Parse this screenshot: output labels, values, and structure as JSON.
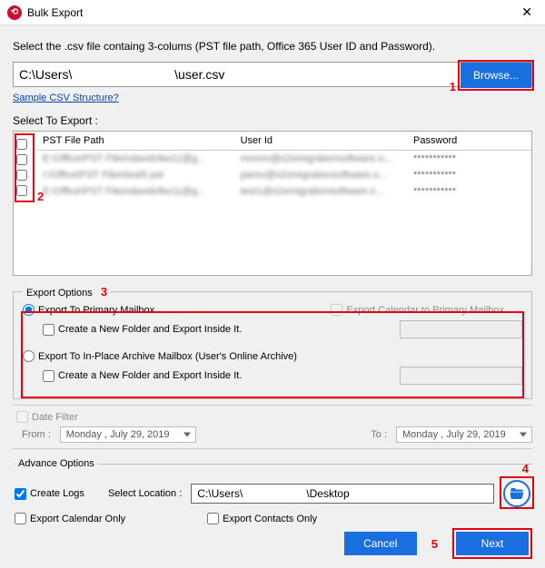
{
  "title": "Bulk Export",
  "instruction": "Select the .csv file containg 3-colums (PST file path, Office 365 User ID and Password).",
  "path_value": "C:\\Users\\                             \\user.csv",
  "browse_label": "Browse...",
  "sample_link": "Sample CSV Structure?",
  "select_label": "Select To Export :",
  "table": {
    "headers": [
      "PST File Path",
      "User Id",
      "Password"
    ],
    "rows": [
      {
        "path": "E:\\Office\\PST Files\\davidclke11@g...",
        "user": "monov@s2omigrationsoftware.o...",
        "pwd": "***********"
      },
      {
        "path": "I:\\Office\\PST Files\\test5.pst",
        "user": "parov@s2omigrationsoftware.o...",
        "pwd": "***********"
      },
      {
        "path": "E:\\Office\\PST Files\\davidclke11@g...",
        "user": "test1@s2omigrationsoftware.o...",
        "pwd": "***********"
      }
    ]
  },
  "annotations": {
    "a1": "1",
    "a2": "2",
    "a3": "3",
    "a4": "4",
    "a5": "5"
  },
  "export_options": {
    "legend": "Export Options",
    "primary": "Export To Primary Mailbox",
    "cal_primary": "Export Calendar to Primary Mailbox",
    "newfolder": "Create a New Folder and Export Inside It.",
    "inplace": "Export To In-Place Archive Mailbox (User's Online Archive)"
  },
  "date_filter": {
    "label": "Date Filter",
    "from": "From :",
    "to": "To :",
    "date": "Monday   ,    July     29, 2019"
  },
  "advance": {
    "legend": "Advance Options",
    "create_logs": "Create Logs",
    "select_loc": "Select Location :",
    "loc_value": "C:\\Users\\                     \\Desktop",
    "cal_only": "Export Calendar Only",
    "contacts_only": "Export Contacts Only"
  },
  "buttons": {
    "cancel": "Cancel",
    "next": "Next"
  }
}
